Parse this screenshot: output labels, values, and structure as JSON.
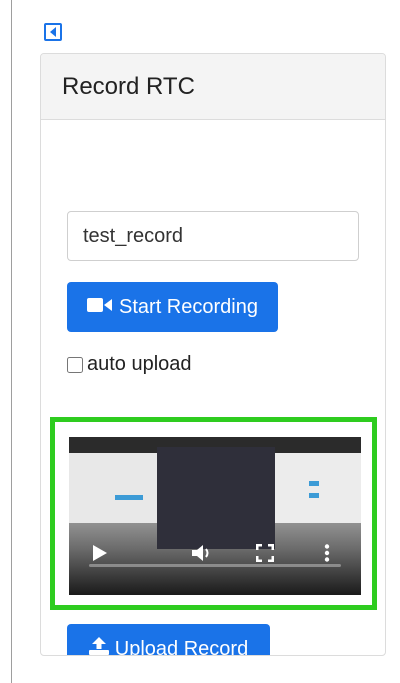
{
  "card": {
    "title": "Record RTC"
  },
  "record_name": {
    "value": "test_record"
  },
  "buttons": {
    "start_label": "Start Recording",
    "upload_label": "Upload Record"
  },
  "auto_upload": {
    "label": "auto upload",
    "checked": false
  },
  "video": {
    "playback_progress": 0
  },
  "colors": {
    "primary": "#1a73e8",
    "highlight_border": "#2ecc1f",
    "header_bg": "#f4f4f4"
  },
  "icons": {
    "toggle": "caret-left-icon",
    "start": "video-camera-icon",
    "upload": "upload-icon",
    "play": "play-icon",
    "volume": "volume-icon",
    "fullscreen": "fullscreen-icon",
    "more": "more-vertical-icon"
  }
}
